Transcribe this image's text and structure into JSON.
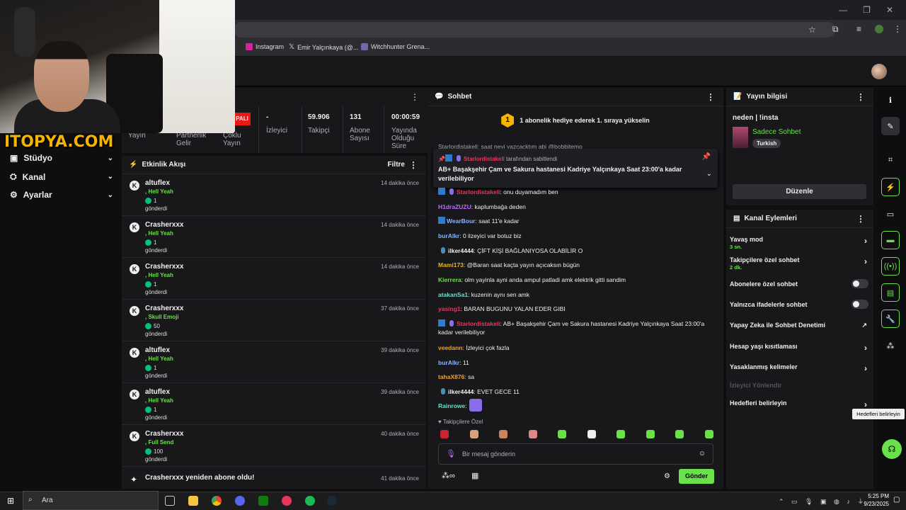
{
  "browser": {
    "bookmarks": [
      {
        "label": "Instagram",
        "icon": "instagram-icon"
      },
      {
        "label": "Emir Yalçınkaya (@...",
        "icon": "x-icon"
      },
      {
        "label": "Witchhunter Grena...",
        "icon": "shield-icon"
      }
    ]
  },
  "overlay": {
    "logo": "ITOPYA.COM"
  },
  "sidebar": {
    "items": [
      {
        "label": "Stüdyo",
        "icon": "studio-icon"
      },
      {
        "label": "Kanal",
        "icon": "channel-icon"
      },
      {
        "label": "Ayarlar",
        "icon": "gear-icon"
      }
    ]
  },
  "stats": {
    "status_badge": "PALI",
    "items": [
      {
        "label": "Yayın",
        "value": ""
      },
      {
        "label": "Partnerlik Gelir",
        "value": ""
      },
      {
        "label": "Çoklu Yayın",
        "value": ""
      },
      {
        "label": "İzleyici",
        "value": "-"
      },
      {
        "label": "Takipçi",
        "value": "59.906"
      },
      {
        "label": "Abone Sayısı",
        "value": "131"
      },
      {
        "label": "Yayında Olduğu Süre",
        "value": "00:00:59"
      }
    ]
  },
  "activity": {
    "title": "Etkinlik Akışı",
    "filter": "Filtre",
    "items": [
      {
        "user": "altuflex",
        "reward": ", Hell Yeah",
        "count": "1",
        "sent": "gönderdi",
        "time": "14 dakika önce"
      },
      {
        "user": "Crasherxxx",
        "reward": ", Hell Yeah",
        "count": "1",
        "sent": "gönderdi",
        "time": "14 dakika önce"
      },
      {
        "user": "Crasherxxx",
        "reward": ", Hell Yeah",
        "count": "1",
        "sent": "gönderdi",
        "time": "14 dakika önce"
      },
      {
        "user": "Crasherxxx",
        "reward": ", Skull Emoji",
        "count": "50",
        "sent": "gönderdi",
        "time": "37 dakika önce"
      },
      {
        "user": "altuflex",
        "reward": ", Hell Yeah",
        "count": "1",
        "sent": "gönderdi",
        "time": "39 dakika önce"
      },
      {
        "user": "altuflex",
        "reward": ", Hell Yeah",
        "count": "1",
        "sent": "gönderdi",
        "time": "39 dakika önce"
      },
      {
        "user": "Crasherxxx",
        "reward": ", Full Send",
        "count": "100",
        "sent": "gönderdi",
        "time": "40 dakika önce"
      }
    ],
    "last": {
      "text": "Crasherxxx yeniden abone oldu!",
      "time": "41 dakika önce"
    }
  },
  "chat": {
    "title": "Sohbet",
    "goal": "1 abonelik hediye ederek 1. sıraya yükselin",
    "goal_number": "1",
    "scrolled_line": "Starlordistakeli: saat neyi yazcacktım abi @bobbitemo",
    "pinned": {
      "by_user": "Starlordistakeli",
      "by_suffix": "tarafından sabitlendi",
      "text": "AB+ Başakşehir Çam ve Sakura hastanesi Kadriye Yalçınkaya Saat 23:00'a kadar verilebiliyor"
    },
    "messages": [
      {
        "user": "Starlordistakeli",
        "text": ": onu duyamadım ben",
        "color": "#e8365b"
      },
      {
        "user": "H1draZUZU",
        "text": ": kaplumbağa deden",
        "color": "#b86bff"
      },
      {
        "user": "WearBour",
        "text": ": saat 11'e kadar",
        "color": "#8ab4ff"
      },
      {
        "user": "burAlkr",
        "text": ": 0 ilzeyici var botuz biz",
        "color": "#8ab4ff"
      },
      {
        "user": "ilker4444",
        "text": ": ÇİFT KİŞİ BAĞLANIYOSA OLABİLİR O",
        "color": "#efeff1"
      },
      {
        "user": "Mami173",
        "text": ": @Baran saat kaçta yayın açıcaksın bügün",
        "color": "#f5b400"
      },
      {
        "user": "Kierrera",
        "text": ": olm yayinla ayni anda ampul patladi amk elektrik gitti sandim",
        "color": "#6ae04b"
      },
      {
        "user": "atakanSa1",
        "text": ": kuzenin aynı sen amk",
        "color": "#6ae0c8"
      },
      {
        "user": "yasing1",
        "text": ": BARAN BUGUNU YALAN EDER GIBI",
        "color": "#e8365b"
      },
      {
        "user": "Starlordistakeli",
        "text": ": AB+ Başakşehir Çam ve Sakura hastanesi Kadriye Yalçınkaya Saat 23:00'a kadar verilebiliyor",
        "color": "#e8365b"
      },
      {
        "user": "veedann",
        "text": ": İzleyici çok fazla",
        "color": "#f5a020"
      },
      {
        "user": "burAlkr",
        "text": ": 11",
        "color": "#8ab4ff"
      },
      {
        "user": "tahaX876",
        "text": ": sa",
        "color": "#f5a020"
      },
      {
        "user": "ilker4444",
        "text": ": EVET GECE 11",
        "color": "#efeff1"
      },
      {
        "user": "Rainrowe",
        "text": ":",
        "color": "#6ae0c8"
      }
    ],
    "emote_bar_label": "Takipçilere Özel",
    "input_placeholder": "Bir mesaj gönderin",
    "send": "Gönder"
  },
  "stream_info": {
    "title": "Yayın bilgisi",
    "stream_title": "neden | !insta",
    "category": "Sadece Sohbet",
    "language": "Turkish",
    "edit": "Düzenle"
  },
  "channel_actions": {
    "title": "Kanal Eylemleri",
    "items": [
      {
        "label": "Yavaş mod",
        "sub": "3 sn.",
        "control": "arrow"
      },
      {
        "label": "Takipçilere özel sohbet",
        "sub": "2 dk.",
        "control": "arrow"
      },
      {
        "label": "Abonelere özel sohbet",
        "sub": "",
        "control": "toggle"
      },
      {
        "label": "Yalnızca ifadelerle sohbet",
        "sub": "",
        "control": "toggle"
      },
      {
        "label": "Yapay Zeka ile Sohbet Denetimi",
        "sub": "",
        "control": "external"
      },
      {
        "label": "Hesap yaşı kısıtlaması",
        "sub": "",
        "control": "arrow"
      },
      {
        "label": "Yasaklanmış kelimeler",
        "sub": "",
        "control": "arrow"
      },
      {
        "label": "İzleyici Yönlendir",
        "sub": "",
        "control": "none"
      },
      {
        "label": "Hedefleri belirleyin",
        "sub": "",
        "control": "arrow"
      }
    ],
    "tooltip": "Hedefleri belirleyin"
  },
  "taskbar": {
    "search": "Ara",
    "time": "5:25 PM",
    "date": "9/23/2025"
  },
  "colors": {
    "accent": "#6ae04b",
    "bg": "#0e0e10",
    "panel": "#18181b"
  }
}
